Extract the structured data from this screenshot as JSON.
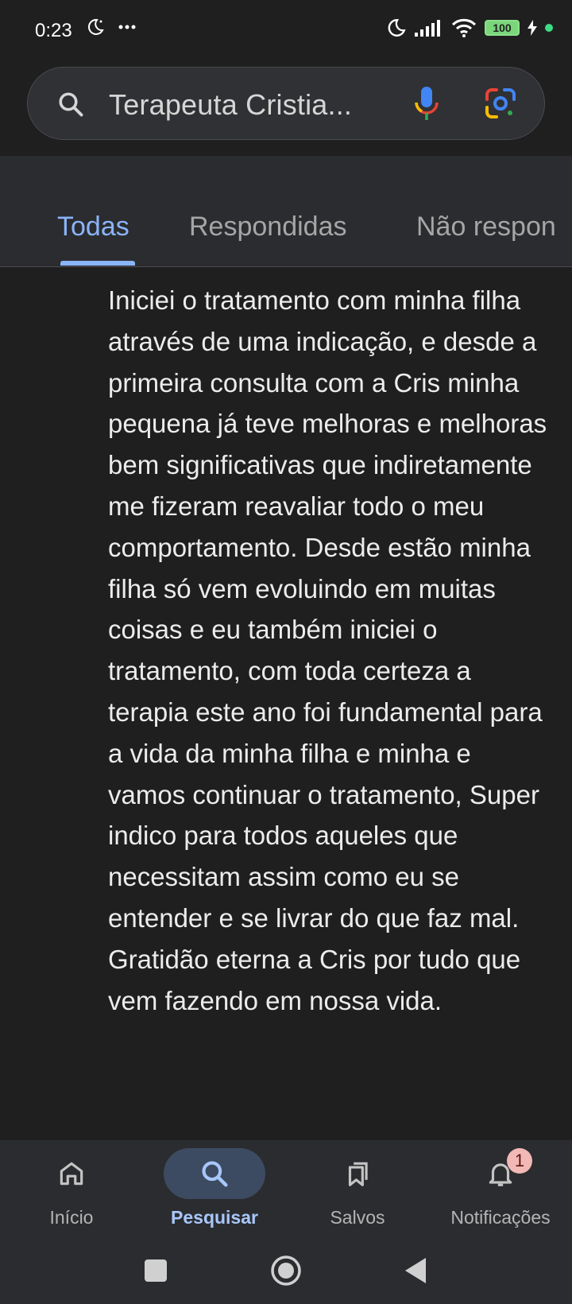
{
  "status_bar": {
    "time": "0:23",
    "battery": "100"
  },
  "search": {
    "query": "Terapeuta Cristia..."
  },
  "tabs": [
    {
      "label": "Todas",
      "active": true
    },
    {
      "label": "Respondidas",
      "active": false
    },
    {
      "label": "Não respon",
      "active": false
    }
  ],
  "review": {
    "text": "Iniciei o tratamento com minha filha através de uma indicação, e desde a primeira consulta com a Cris minha pequena já teve melhoras e melhoras bem significativas que indiretamente me fizeram reavaliar todo o meu comportamento. Desde estão minha filha só vem evoluindo em muitas coisas e eu também iniciei o tratamento, com toda certeza a terapia este ano foi fundamental para a vida da minha filha e minha e vamos continuar o tratamento, Super indico para todos aqueles que necessitam assim como eu se entender e se livrar do que faz mal. Gratidão eterna a Cris por tudo que vem fazendo em nossa vida."
  },
  "bottom_nav": {
    "items": [
      {
        "label": "Início",
        "icon": "home-icon"
      },
      {
        "label": "Pesquisar",
        "icon": "search-icon",
        "active": true
      },
      {
        "label": "Salvos",
        "icon": "bookmarks-icon"
      },
      {
        "label": "Notificações",
        "icon": "bell-icon",
        "badge": "1"
      }
    ]
  },
  "colors": {
    "background": "#1f1f1f",
    "surface": "#2b2c2f",
    "accent": "#8ab4f8"
  }
}
